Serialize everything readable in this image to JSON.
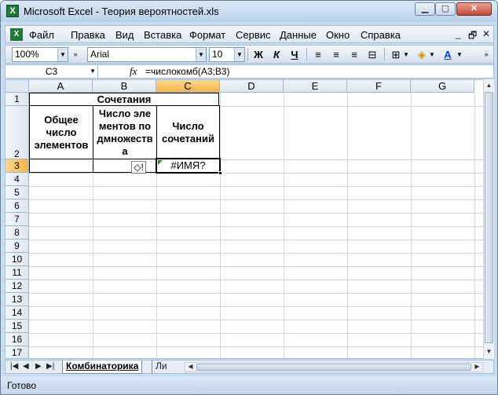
{
  "window": {
    "title": "Microsoft Excel - Теория вероятностей.xls"
  },
  "menu": [
    "Файл",
    "Правка",
    "Вид",
    "Вставка",
    "Формат",
    "Сервис",
    "Данные",
    "Окно",
    "Справка"
  ],
  "toolbar": {
    "zoom": "100%",
    "font": "Arial",
    "font_size": "10",
    "bold": "Ж",
    "italic": "К",
    "underline": "Ч"
  },
  "formula_bar": {
    "name_box": "C3",
    "fx": "fx",
    "formula": "=числокомб(A3;B3)"
  },
  "columns": [
    "A",
    "B",
    "C",
    "D",
    "E",
    "F",
    "G"
  ],
  "rows": [
    "1",
    "2",
    "3",
    "4",
    "5",
    "6",
    "7",
    "8",
    "9",
    "10",
    "11",
    "12",
    "13",
    "14",
    "15",
    "16",
    "17"
  ],
  "sheet": {
    "title": "Сочетания",
    "headers": {
      "a": "Общее число элементов",
      "b": "Число элементов подмножества",
      "c": "Число сочетаний"
    },
    "c3": "#ИМЯ?"
  },
  "tabs": {
    "active": "Комбинаторика",
    "other": "Ли"
  },
  "status": "Готово"
}
